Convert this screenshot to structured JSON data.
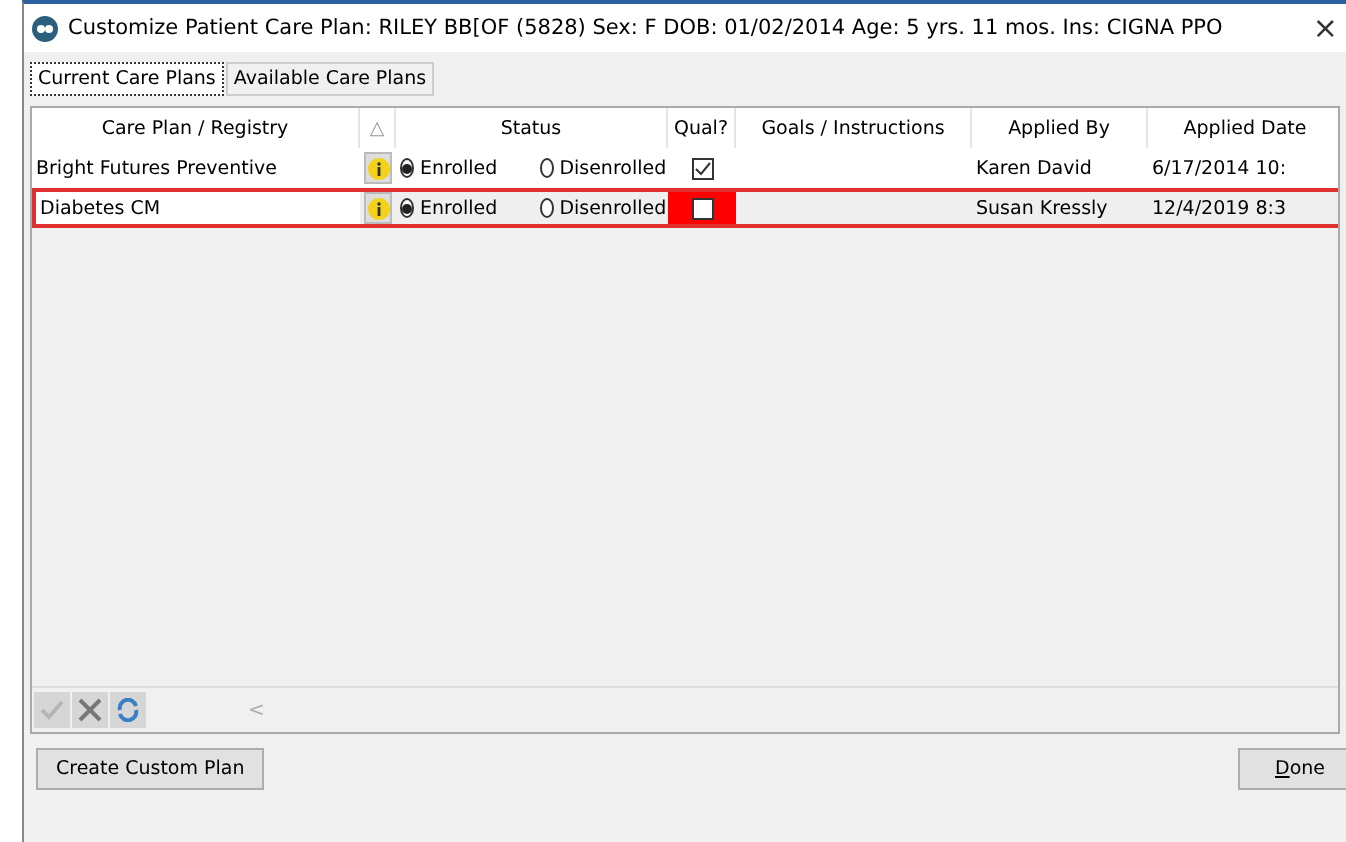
{
  "window": {
    "title": "Customize Patient Care Plan: RILEY BB[OF (5828)  Sex: F  DOB: 01/02/2014  Age: 5 yrs. 11 mos.  Ins: CIGNA PPO",
    "close": "×"
  },
  "tabs": [
    {
      "label": "Current Care Plans",
      "selected": true
    },
    {
      "label": "Available Care Plans",
      "selected": false
    }
  ],
  "table": {
    "columns": [
      "Care Plan / Registry",
      "Status",
      "Qual?",
      "Goals / Instructions",
      "Applied By",
      "Applied Date"
    ],
    "sort_indicator": "△",
    "rows": [
      {
        "plan": "Bright Futures Preventive",
        "status_options": [
          "Enrolled",
          "Disenrolled"
        ],
        "enrolled": true,
        "qualified": true,
        "goals": "",
        "applied_by": "Karen David",
        "applied_date": "6/17/2014 10:",
        "selected": false
      },
      {
        "plan": "Diabetes CM",
        "status_options": [
          "Enrolled",
          "Disenrolled"
        ],
        "enrolled": true,
        "qualified": false,
        "goals": "",
        "applied_by": "Susan Kressly",
        "applied_date": "12/4/2019 8:3",
        "selected": true
      }
    ]
  },
  "scroll_left": "<",
  "buttons": {
    "custom": "Create Custom Plan",
    "done": "Done"
  }
}
